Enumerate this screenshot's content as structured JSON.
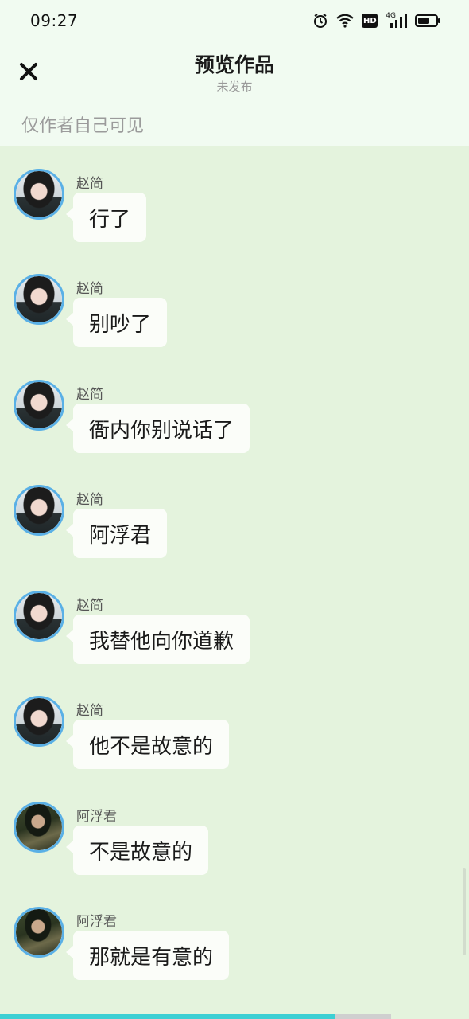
{
  "status_bar": {
    "time": "09:27",
    "icons": [
      "alarm-icon",
      "wifi-icon",
      "hd-icon",
      "signal-4g-icon",
      "battery-icon"
    ],
    "hd_label": "HD",
    "network_label": "4G"
  },
  "header": {
    "title": "预览作品",
    "subtitle": "未发布",
    "close_icon": "close-icon"
  },
  "visibility_note": "仅作者自己可见",
  "messages": [
    {
      "sender": "赵简",
      "text": "行了",
      "avatar": "zhao"
    },
    {
      "sender": "赵简",
      "text": "别吵了",
      "avatar": "zhao"
    },
    {
      "sender": "赵简",
      "text": "衙内你别说话了",
      "avatar": "zhao"
    },
    {
      "sender": "赵简",
      "text": "阿浮君",
      "avatar": "zhao"
    },
    {
      "sender": "赵简",
      "text": "我替他向你道歉",
      "avatar": "zhao"
    },
    {
      "sender": "赵简",
      "text": "他不是故意的",
      "avatar": "zhao"
    },
    {
      "sender": "阿浮君",
      "text": "不是故意的",
      "avatar": "afu"
    },
    {
      "sender": "阿浮君",
      "text": "那就是有意的",
      "avatar": "afu"
    }
  ],
  "progress": 0.855,
  "colors": {
    "page_bg": "#e4f3dd",
    "header_bg": "#f1fbf1",
    "bubble_bg": "#fbfdf9",
    "avatar_ring": "#5ab0e6",
    "progress_fill": "#3ccfd3"
  }
}
